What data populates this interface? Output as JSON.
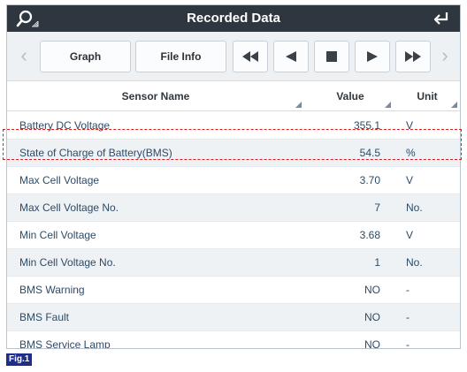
{
  "header": {
    "title": "Recorded Data"
  },
  "toolbar": {
    "graph_label": "Graph",
    "file_info_label": "File Info"
  },
  "table": {
    "columns": {
      "sensor_name": "Sensor Name",
      "value": "Value",
      "unit": "Unit"
    },
    "rows": [
      {
        "name": "Battery DC Voltage",
        "value": "355.1",
        "unit": "V"
      },
      {
        "name": "State of Charge of Battery(BMS)",
        "value": "54.5",
        "unit": "%"
      },
      {
        "name": "Max Cell Voltage",
        "value": "3.70",
        "unit": "V"
      },
      {
        "name": "Max Cell Voltage No.",
        "value": "7",
        "unit": "No."
      },
      {
        "name": "Min Cell Voltage",
        "value": "3.68",
        "unit": "V"
      },
      {
        "name": "Min Cell Voltage No.",
        "value": "1",
        "unit": "No."
      },
      {
        "name": "BMS Warning",
        "value": "NO",
        "unit": "-"
      },
      {
        "name": "BMS Fault",
        "value": "NO",
        "unit": "-"
      },
      {
        "name": "BMS Service Lamp",
        "value": "NO",
        "unit": "-"
      }
    ],
    "highlighted_row": "State of Charge of Battery(BMS)"
  },
  "figure_label": "Fig.1",
  "icons": {
    "search": "search-icon",
    "back": "return-arrow-icon",
    "prev": "chevron-left-icon",
    "next": "chevron-right-icon",
    "rewind": "rewind-icon",
    "step_back": "step-back-icon",
    "stop": "stop-icon",
    "play": "play-icon",
    "fast_forward": "fast-forward-icon"
  },
  "colors": {
    "title_bar": "#2e3740",
    "highlight": "#d81b1b",
    "row_alt": "#eff2f5",
    "text_row": "#2e4a66",
    "fig_badge": "#1e2d8c"
  }
}
